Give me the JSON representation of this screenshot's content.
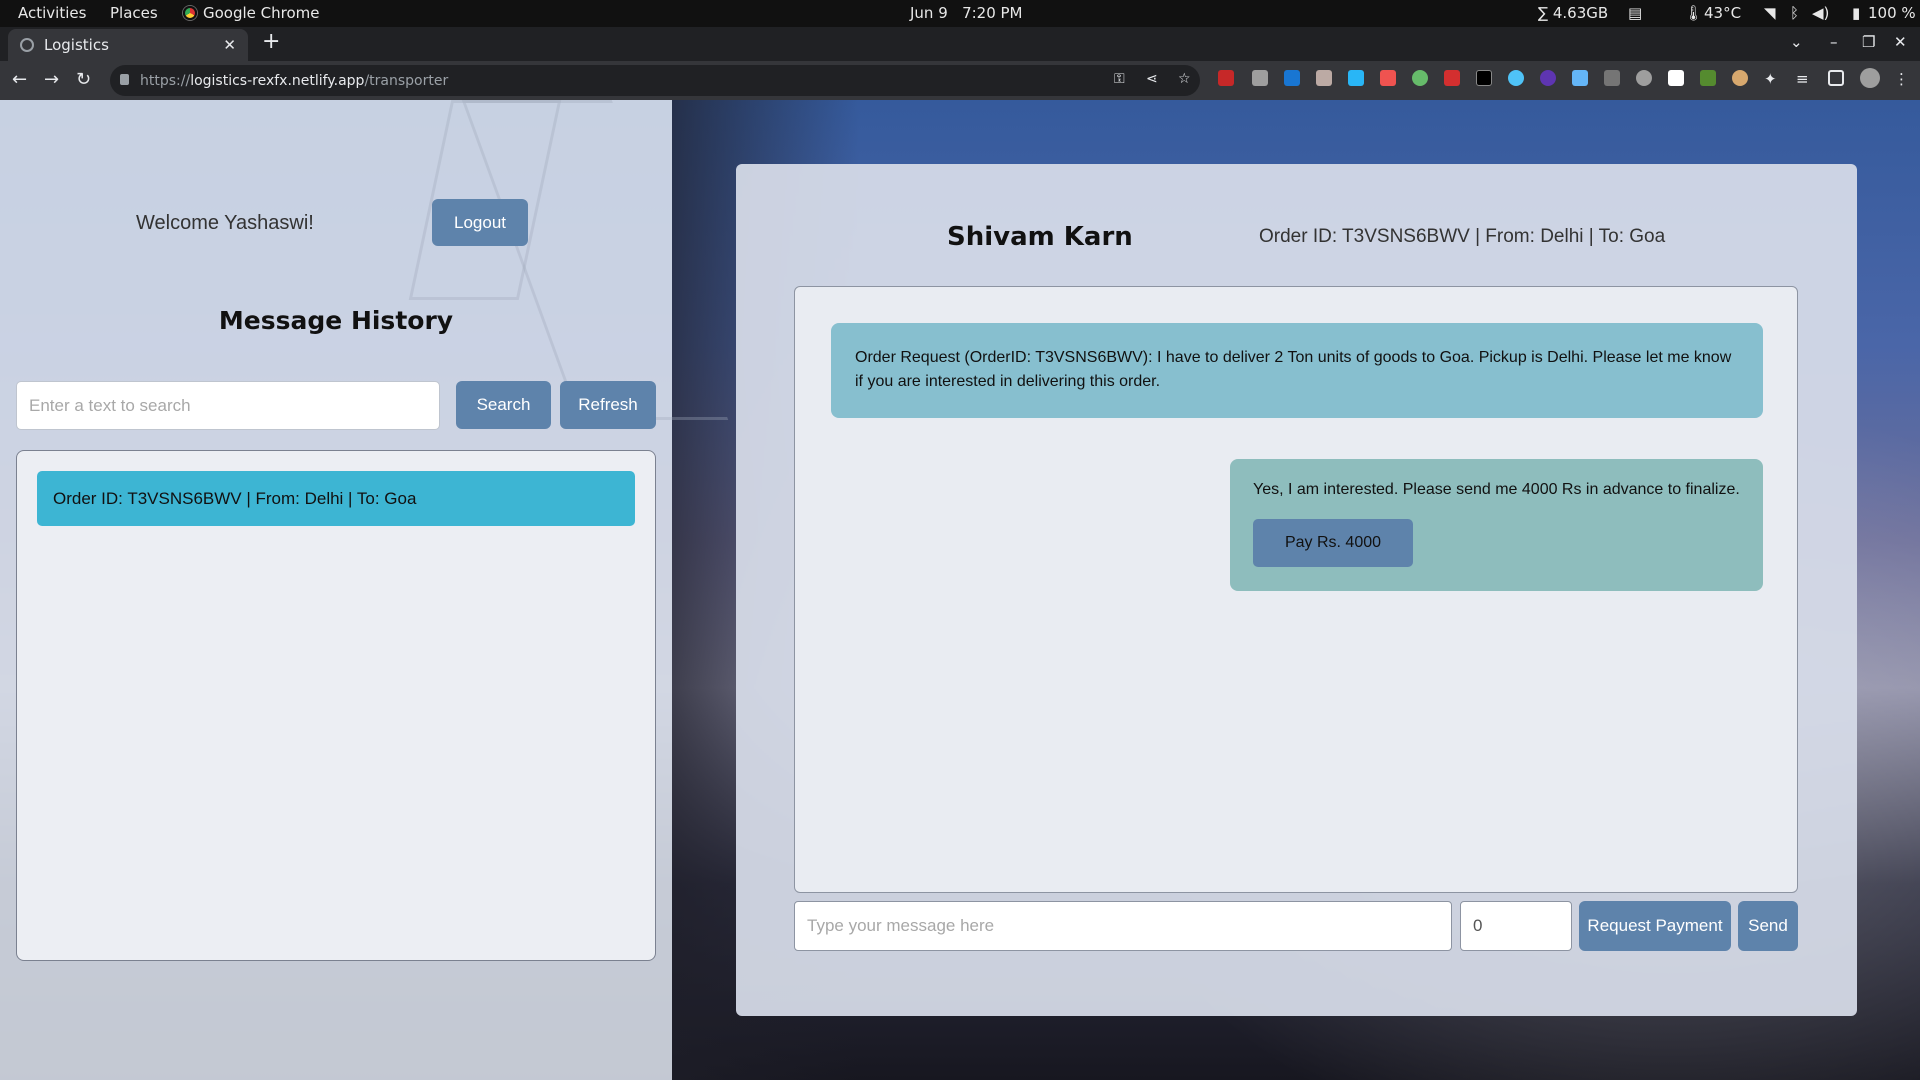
{
  "system_bar": {
    "activities": "Activities",
    "places": "Places",
    "app_name": "Google Chrome",
    "date": "Jun 9",
    "time": "7:20 PM",
    "memory": "∑ 4.63GB",
    "temperature": "43°C",
    "battery": "100 %"
  },
  "browser": {
    "tab_title": "Logistics",
    "url_scheme": "https://",
    "url_host": "logistics-rexfx.netlify.app",
    "url_path": "/transporter"
  },
  "sidebar": {
    "welcome": "Welcome Yashaswi!",
    "logout_label": "Logout",
    "history_title": "Message History",
    "search_placeholder": "Enter a text to search",
    "search_label": "Search",
    "refresh_label": "Refresh",
    "history_items": [
      {
        "label": "Order ID: T3VSNS6BWV | From: Delhi | To: Goa"
      }
    ]
  },
  "chat": {
    "contact_name": "Shivam Karn",
    "order_summary": "Order ID: T3VSNS6BWV | From: Delhi | To: Goa",
    "messages": [
      {
        "direction": "incoming",
        "text": "Order Request (OrderID: T3VSNS6BWV): I have to deliver 2 Ton units of goods to Goa. Pickup is Delhi. Please let me know if you are interested in delivering this order."
      },
      {
        "direction": "outgoing",
        "text": "Yes, I am interested. Please send me 4000 Rs in advance to finalize.",
        "button_label": "Pay Rs. 4000"
      }
    ],
    "message_placeholder": "Type your message here",
    "amount_value": "0",
    "request_payment_label": "Request Payment",
    "send_label": "Send"
  }
}
